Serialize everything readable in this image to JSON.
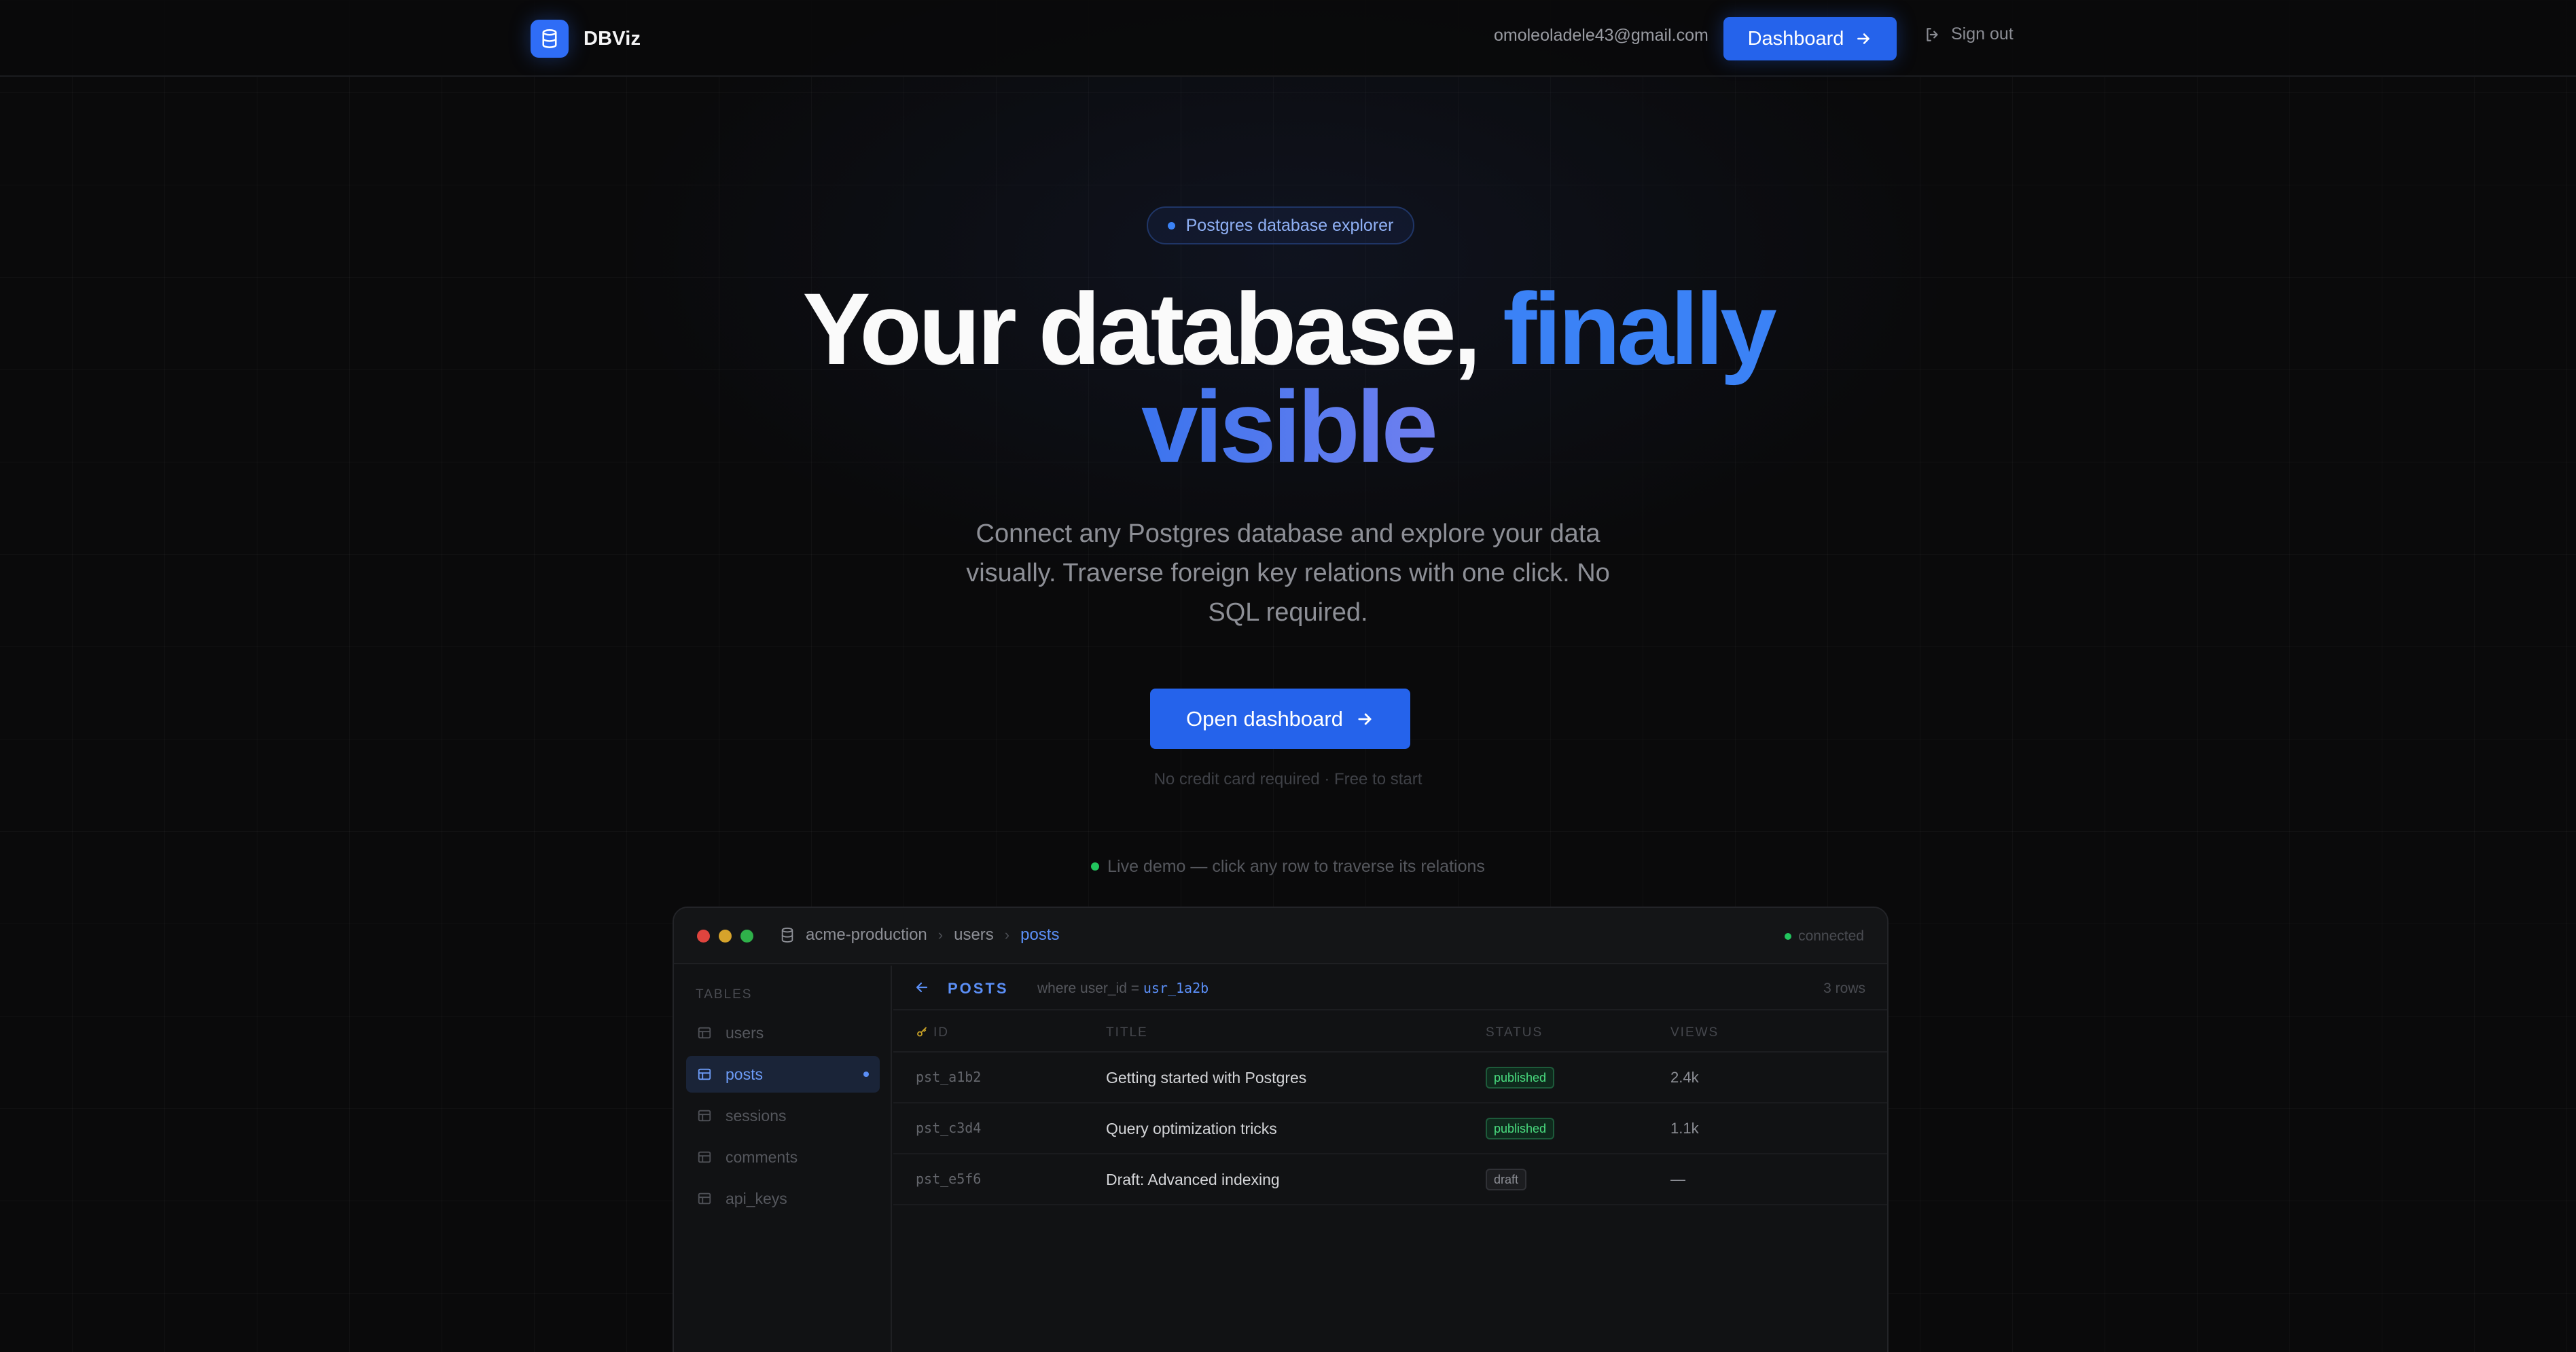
{
  "header": {
    "brand": "DBViz",
    "user_email": "omoleoladele43@gmail.com",
    "dashboard_label": "Dashboard",
    "signout_label": "Sign out"
  },
  "hero": {
    "badge": "Postgres database explorer",
    "title_part1": "Your database, ",
    "title_accent1": "finally",
    "title_accent2": "visible",
    "subtitle": "Connect any Postgres database and explore your data visually. Traverse foreign key relations with one click. No SQL required.",
    "cta_label": "Open dashboard",
    "fineprint": "No credit card required · Free to start",
    "live_demo": "Live demo — click any row to traverse its relations"
  },
  "demo": {
    "breadcrumb": [
      "acme-production",
      "users",
      "posts"
    ],
    "connection_status": "connected",
    "sidebar": {
      "heading": "TABLES",
      "items": [
        {
          "label": "users"
        },
        {
          "label": "posts"
        },
        {
          "label": "sessions"
        },
        {
          "label": "comments"
        },
        {
          "label": "api_keys"
        }
      ]
    },
    "query": {
      "table_name": "POSTS",
      "where_prefix": "where user_id = ",
      "where_value": "usr_1a2b",
      "row_count": "3 rows"
    },
    "columns": [
      "ID",
      "TITLE",
      "STATUS",
      "VIEWS"
    ],
    "rows": [
      {
        "id": "pst_a1b2",
        "title": "Getting started with Postgres",
        "status": "published",
        "views": "2.4k"
      },
      {
        "id": "pst_c3d4",
        "title": "Query optimization tricks",
        "status": "published",
        "views": "1.1k"
      },
      {
        "id": "pst_e5f6",
        "title": "Draft: Advanced indexing",
        "status": "draft",
        "views": "—"
      }
    ]
  },
  "colors": {
    "accent": "#2563eb",
    "accent_text": "#3b82f6",
    "background": "#0a0a0b",
    "success": "#22c55e",
    "traffic_red": "#e0443e",
    "traffic_yellow": "#d6a32b",
    "traffic_green": "#2fb14a"
  },
  "icons": {
    "brand": "database-icon",
    "dashboard_arrow": "arrow-right-icon",
    "signout": "log-out-icon",
    "table": "table-icon",
    "back": "arrow-left-icon",
    "primary_key": "key-icon"
  }
}
